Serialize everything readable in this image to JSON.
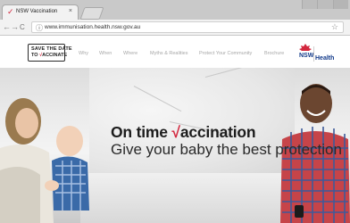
{
  "browser": {
    "tab_title": "NSW Vaccination",
    "tab_close": "×",
    "url": "www.immunisation.health.nsw.gov.au"
  },
  "site": {
    "logo_line1": "SAVE THE DATE",
    "logo_line2_prefix": "TO ",
    "logo_line2_tick": "√",
    "logo_line2_rest": "ACCINATE",
    "nav": [
      "Why",
      "When",
      "Where",
      "Myths & Realities",
      "Protect Your Community",
      "Brochure"
    ],
    "nsw_word": "NSW",
    "health_word": "Health"
  },
  "hero": {
    "headline_prefix": "On time ",
    "headline_tick": "√",
    "headline_rest": "accination",
    "subline": "Give your baby the best protection"
  },
  "colors": {
    "accent_red": "#d3273e",
    "nsw_blue": "#123a8a"
  }
}
